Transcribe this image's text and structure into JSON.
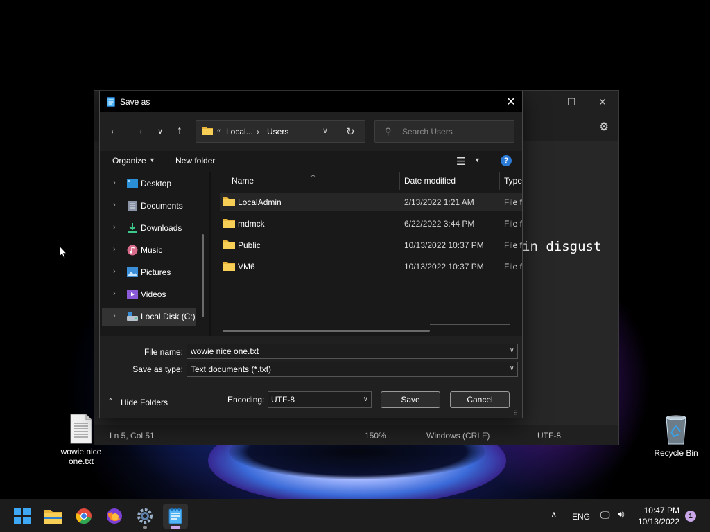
{
  "desktop": {
    "file_icon_label": "wowie nice one.txt",
    "recycle_bin_label": "Recycle Bin"
  },
  "notepad": {
    "minimize_glyph": "—",
    "maximize_glyph": "☐",
    "close_glyph": "✕",
    "editor_visible_text": "in disgust",
    "status": {
      "position": "Ln 5, Col 51",
      "zoom": "150%",
      "line_ending": "Windows (CRLF)",
      "encoding": "UTF-8"
    }
  },
  "dialog": {
    "title": "Save as",
    "close_glyph": "✕",
    "address": {
      "overflow": "«",
      "segment1": "Local...",
      "separator": "›",
      "segment2": "Users"
    },
    "search": {
      "placeholder": "Search Users"
    },
    "toolbar": {
      "organize": "Organize",
      "new_folder": "New folder",
      "help": "?"
    },
    "nav_items": [
      {
        "label": "Desktop",
        "icon": "desktop-icon"
      },
      {
        "label": "Documents",
        "icon": "documents-icon"
      },
      {
        "label": "Downloads",
        "icon": "downloads-icon"
      },
      {
        "label": "Music",
        "icon": "music-icon"
      },
      {
        "label": "Pictures",
        "icon": "pictures-icon"
      },
      {
        "label": "Videos",
        "icon": "videos-icon"
      },
      {
        "label": "Local Disk (C:)",
        "icon": "drive-icon",
        "selected": true
      }
    ],
    "columns": {
      "name": "Name",
      "date": "Date modified",
      "type": "Type"
    },
    "files": [
      {
        "name": "LocalAdmin",
        "date": "2/13/2022 1:21 AM",
        "type": "File folder"
      },
      {
        "name": "mdmck",
        "date": "6/22/2022 3:44 PM",
        "type": "File folder"
      },
      {
        "name": "Public",
        "date": "10/13/2022 10:37 PM",
        "type": "File folder"
      },
      {
        "name": "VM6",
        "date": "10/13/2022 10:37 PM",
        "type": "File folder"
      }
    ],
    "file_name_label": "File name:",
    "file_name_value": "wowie nice one.txt",
    "save_as_type_label": "Save as type:",
    "save_as_type_value": "Text documents (*.txt)",
    "hide_folders": "Hide Folders",
    "encoding_label": "Encoding:",
    "encoding_value": "UTF-8",
    "save_button": "Save",
    "cancel_button": "Cancel"
  },
  "taskbar": {
    "apps": [
      "start",
      "file-explorer",
      "chrome",
      "firefox",
      "settings",
      "notepad"
    ],
    "tray": {
      "language": "ENG",
      "time": "10:47 PM",
      "date": "10/13/2022",
      "notification_count": "1"
    }
  },
  "colors": {
    "accent": "#2a7ad6",
    "folder_yellow": "#f4c542",
    "dialog_bg": "#191919",
    "notification_badge": "#c9a6e8"
  }
}
